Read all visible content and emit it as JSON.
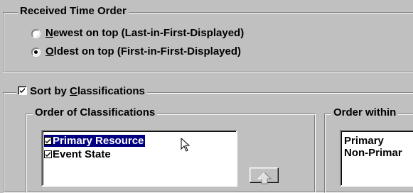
{
  "received_time_order": {
    "title": "Received Time Order",
    "options": [
      {
        "label_hotkey": "N",
        "label_rest": "ewest on top (Last-in-First-Displayed)",
        "selected": false
      },
      {
        "label_hotkey": "O",
        "label_rest": "ldest on top (First-in-First-Displayed)",
        "selected": true
      }
    ]
  },
  "sort_by_classifications": {
    "label_before": "Sort by ",
    "label_hotkey": "C",
    "label_after": "lassifications",
    "checked": true
  },
  "order_of_classifications": {
    "title": "Order of Classifications",
    "items": [
      {
        "label": "Primary Resource",
        "checked": true,
        "selected": true
      },
      {
        "label": "Event State",
        "checked": true,
        "selected": false
      }
    ],
    "move_up_icon": "up-arrow-icon"
  },
  "order_within": {
    "title": "Order within",
    "items": [
      "Primary",
      "Non-Primar"
    ]
  },
  "colors": {
    "face": "#c0c0c0",
    "selection": "#000080"
  }
}
